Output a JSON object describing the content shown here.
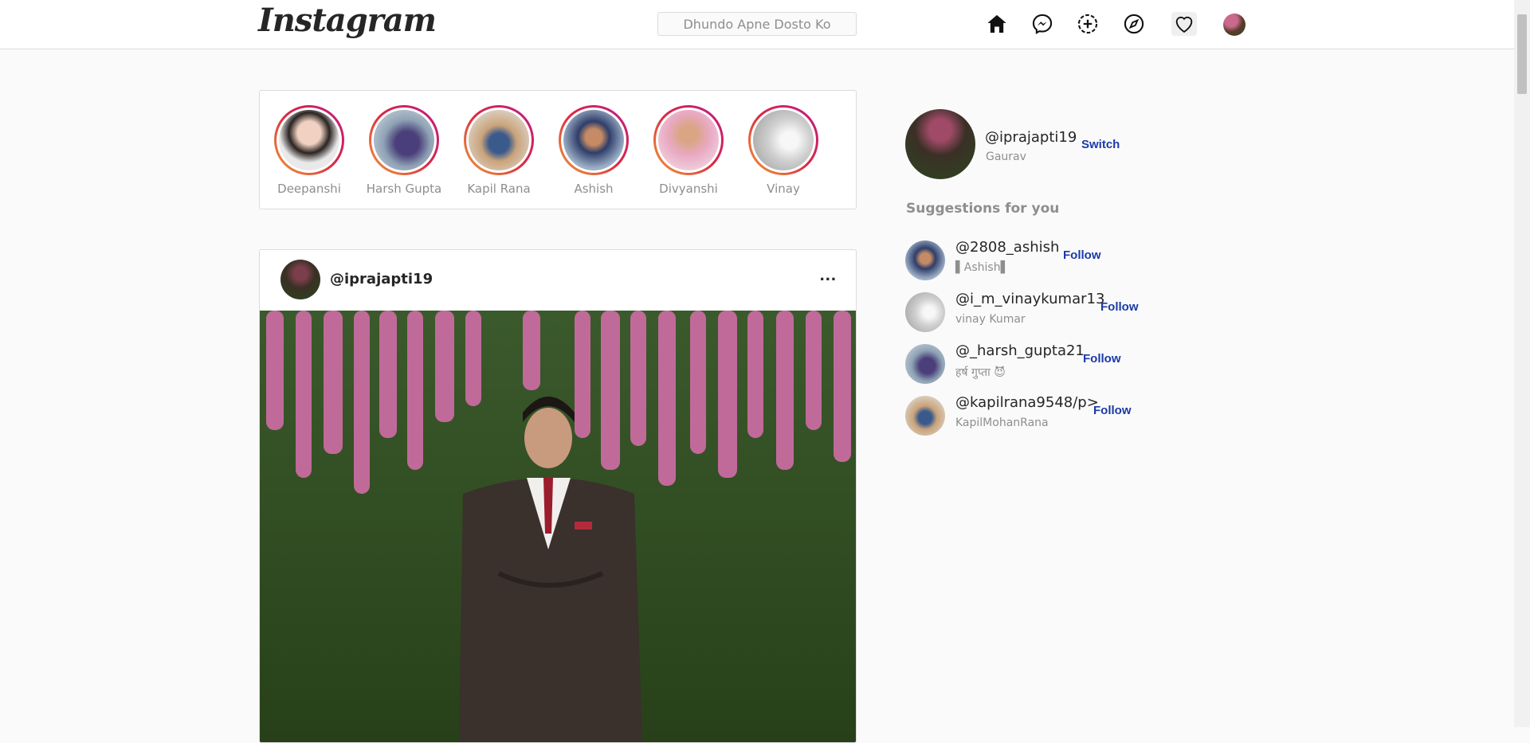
{
  "header": {
    "logo_text": "Instagram",
    "search_placeholder": "Dhundo Apne Dosto Ko",
    "icons": [
      "home-icon",
      "messenger-icon",
      "new-post-icon",
      "explore-icon",
      "activity-heart-icon",
      "profile-avatar"
    ]
  },
  "stories": [
    {
      "name": "Deepanshi"
    },
    {
      "name": "Harsh Gupta"
    },
    {
      "name": "Kapil Rana"
    },
    {
      "name": "Ashish"
    },
    {
      "name": "Divyanshi"
    },
    {
      "name": "Vinay"
    }
  ],
  "post": {
    "username": "@iprajapti19",
    "more_label": "..."
  },
  "sidebar": {
    "current_user": {
      "handle": "@iprajapti19",
      "name": "Gaurav",
      "switch_label": "Switch"
    },
    "suggestions_title": "Suggestions for you",
    "suggestions": [
      {
        "handle": "@2808_ashish",
        "sub": "▌Ashish▌",
        "follow_label": "Follow"
      },
      {
        "handle": "@i_m_vinaykumar13",
        "sub": "vinay Kumar",
        "follow_label": "Follow"
      },
      {
        "handle": "@_harsh_gupta21",
        "sub": "हर्ष गुप्ता 😈",
        "follow_label": "Follow"
      },
      {
        "handle": "@kapilrana9548/p>",
        "sub": "KapilMohanRana",
        "follow_label": "Follow"
      }
    ]
  },
  "colors": {
    "story_ring_gradient": [
      "#f09433",
      "#dc2743",
      "#bc1888"
    ],
    "link_blue": "#1a3aa8",
    "border": "#dbdbdb",
    "background": "#fafafa"
  }
}
